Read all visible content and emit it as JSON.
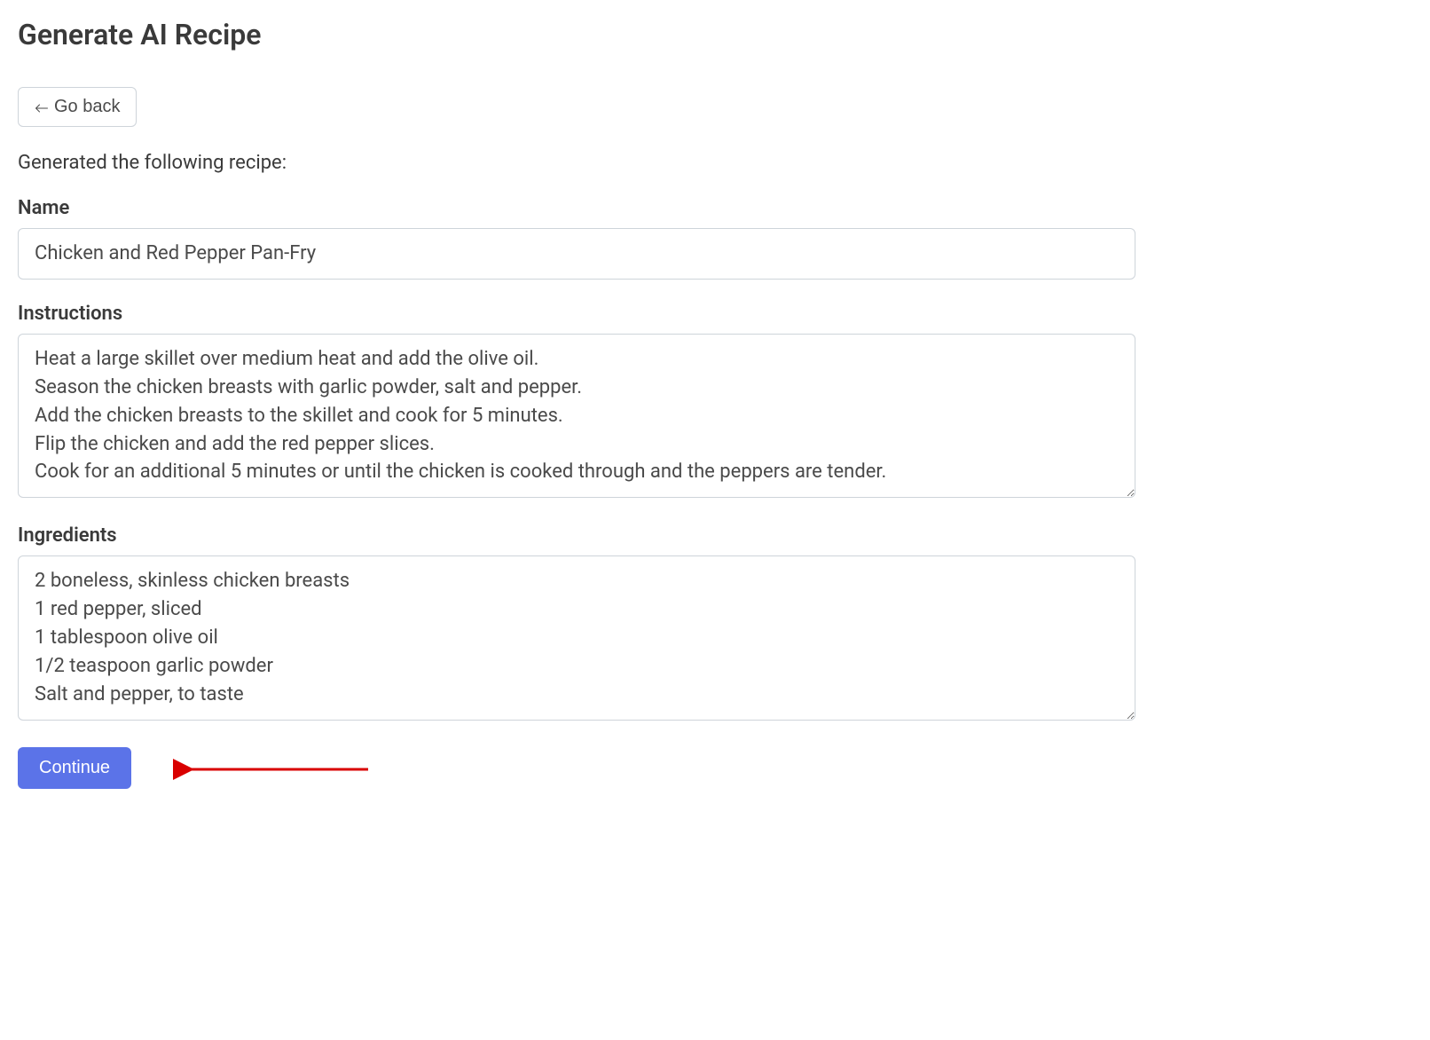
{
  "page": {
    "title": "Generate AI Recipe",
    "go_back_label": "Go back",
    "subtitle": "Generated the following recipe:",
    "continue_label": "Continue"
  },
  "form": {
    "name": {
      "label": "Name",
      "value": "Chicken and Red Pepper Pan-Fry"
    },
    "instructions": {
      "label": "Instructions",
      "value": "Heat a large skillet over medium heat and add the olive oil.\nSeason the chicken breasts with garlic powder, salt and pepper.\nAdd the chicken breasts to the skillet and cook for 5 minutes.\nFlip the chicken and add the red pepper slices.\nCook for an additional 5 minutes or until the chicken is cooked through and the peppers are tender."
    },
    "ingredients": {
      "label": "Ingredients",
      "value": "2 boneless, skinless chicken breasts\n1 red pepper, sliced\n1 tablespoon olive oil\n1/2 teaspoon garlic powder\nSalt and pepper, to taste"
    }
  }
}
